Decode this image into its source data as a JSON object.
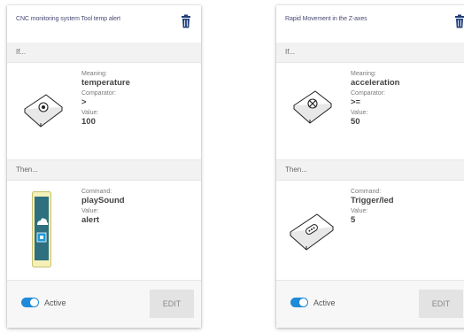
{
  "cards": [
    {
      "title": "CNC monitoring system Tool temp alert",
      "if_label": "If...",
      "then_label": "Then...",
      "condition": {
        "meaning_label": "Meaning:",
        "meaning_value": "temperature",
        "comparator_label": "Comparator:",
        "comparator_value": ">",
        "value_label": "Value:",
        "value_value": "100"
      },
      "action": {
        "command_label": "Command:",
        "command_value": "playSound",
        "value_label": "Value:",
        "value_value": "alert"
      },
      "active_label": "Active",
      "active": true,
      "edit_label": "EDIT"
    },
    {
      "title": "Rapid Movement in the Z-axes",
      "if_label": "If...",
      "then_label": "Then...",
      "condition": {
        "meaning_label": "Meaning:",
        "meaning_value": "acceleration",
        "comparator_label": "Comparator:",
        "comparator_value": ">=",
        "value_label": "Value:",
        "value_value": "50"
      },
      "action": {
        "command_label": "Command:",
        "command_value": "Trigger/led",
        "value_label": "Value:",
        "value_value": "5"
      },
      "active_label": "Active",
      "active": true,
      "edit_label": "EDIT"
    }
  ],
  "colors": {
    "toggle_on": "#1e8ad8",
    "title_text": "#4a4a75",
    "icon_blue": "#1f3e7a",
    "phone_screen": "#2e6f80"
  },
  "icons": [
    "trash-icon",
    "sensor-device-icon",
    "phone-device-icon"
  ]
}
